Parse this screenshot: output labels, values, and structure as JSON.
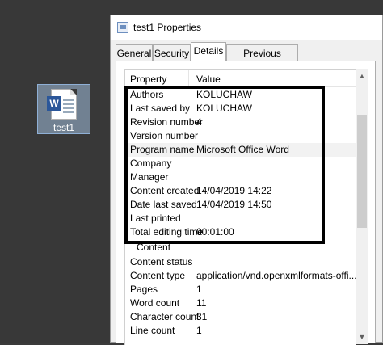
{
  "desktop": {
    "icon": {
      "label": "test1",
      "icon_name": "word-document-icon",
      "badge": "W"
    }
  },
  "window": {
    "title": "test1 Properties",
    "icon_name": "properties-icon",
    "tabs": [
      {
        "label": "General",
        "active": false
      },
      {
        "label": "Security",
        "active": false
      },
      {
        "label": "Details",
        "active": true
      },
      {
        "label": "Previous Versions",
        "active": false
      }
    ]
  },
  "details": {
    "header": {
      "property": "Property",
      "value": "Value"
    },
    "rows": [
      {
        "property": "Authors",
        "value": "KOLUCHAW"
      },
      {
        "property": "Last saved by",
        "value": "KOLUCHAW"
      },
      {
        "property": "Revision number",
        "value": "4"
      },
      {
        "property": "Version number",
        "value": ""
      },
      {
        "property": "Program name",
        "value": "Microsoft Office Word"
      },
      {
        "property": "Company",
        "value": ""
      },
      {
        "property": "Manager",
        "value": ""
      },
      {
        "property": "Content created",
        "value": "14/04/2019 14:22"
      },
      {
        "property": "Date last saved",
        "value": "14/04/2019 14:50"
      },
      {
        "property": "Last printed",
        "value": ""
      },
      {
        "property": "Total editing time",
        "value": "00:01:00"
      }
    ],
    "section_label": "Content",
    "content_rows": [
      {
        "property": "Content status",
        "value": ""
      },
      {
        "property": "Content type",
        "value": "application/vnd.openxmlformats-offi..."
      },
      {
        "property": "Pages",
        "value": "1"
      },
      {
        "property": "Word count",
        "value": "11"
      },
      {
        "property": "Character count",
        "value": "31"
      },
      {
        "property": "Line count",
        "value": "1"
      }
    ]
  },
  "scrollbar": {
    "up_icon": "scroll-up-arrow-icon",
    "down_icon": "scroll-down-arrow-icon"
  },
  "colors": {
    "highlight_border": "#000000",
    "word_blue": "#2b579a"
  }
}
